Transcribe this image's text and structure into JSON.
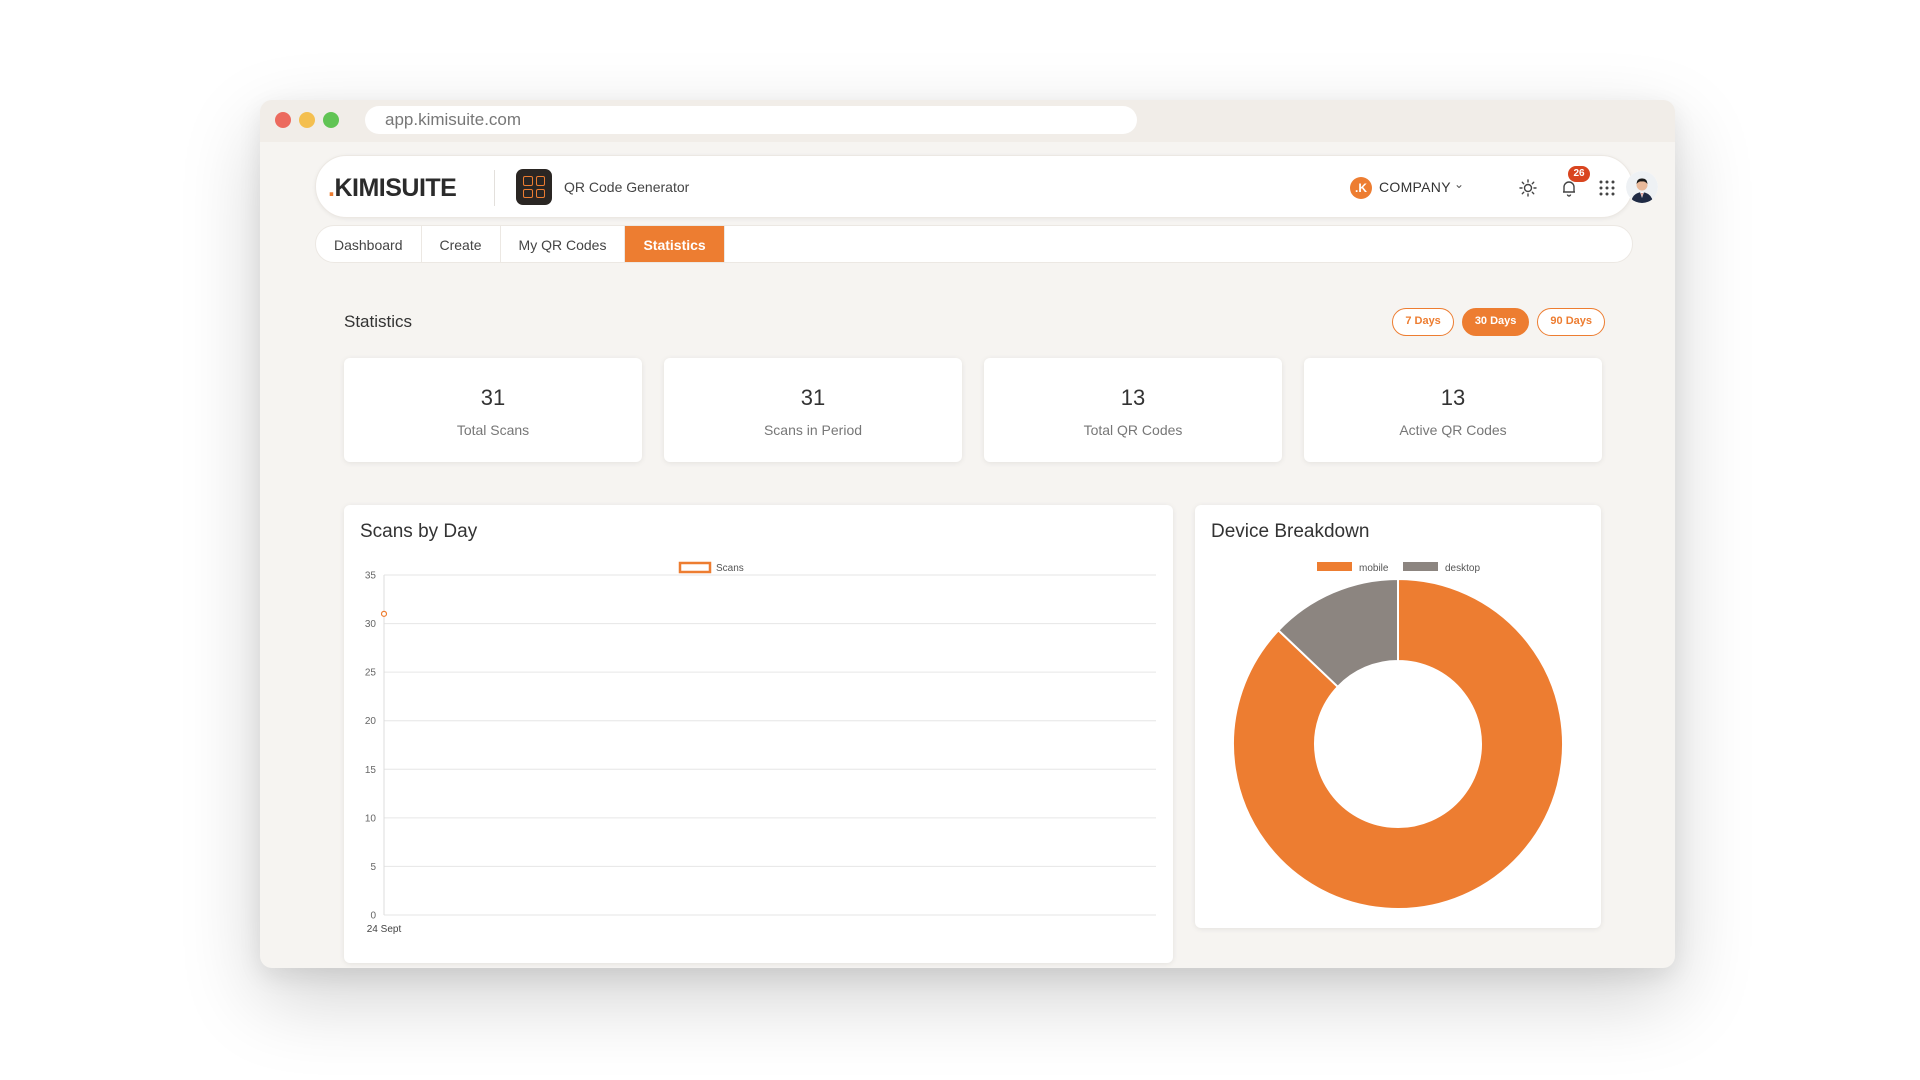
{
  "browser": {
    "url": "app.kimisuite.com"
  },
  "header": {
    "logo_prefix": ".",
    "logo_text": "KIMISUITE",
    "app_name": "QR Code Generator",
    "company_initial": ".K",
    "company_name": "COMPANY",
    "notification_count": "26"
  },
  "tabs": [
    {
      "label": "Dashboard"
    },
    {
      "label": "Create"
    },
    {
      "label": "My QR Codes"
    },
    {
      "label": "Statistics",
      "active": true
    }
  ],
  "statistics": {
    "title": "Statistics",
    "ranges": [
      {
        "label": "7 Days"
      },
      {
        "label": "30 Days",
        "active": true
      },
      {
        "label": "90 Days"
      }
    ],
    "cards": [
      {
        "value": "31",
        "label": "Total Scans"
      },
      {
        "value": "31",
        "label": "Scans in Period"
      },
      {
        "value": "13",
        "label": "Total QR Codes"
      },
      {
        "value": "13",
        "label": "Active QR Codes"
      }
    ]
  },
  "colors": {
    "accent": "#ed7d31",
    "desktop": "#8c8580"
  },
  "chart_data": [
    {
      "type": "line",
      "title": "Scans by Day",
      "x": [
        "24 Sept"
      ],
      "series": [
        {
          "name": "Scans",
          "values": [
            31
          ]
        }
      ],
      "ylim": [
        0,
        35
      ],
      "yticks": [
        0,
        5,
        10,
        15,
        20,
        25,
        30,
        35
      ],
      "grid": true,
      "legend": "top-center"
    },
    {
      "type": "pie",
      "title": "Device Breakdown",
      "labels": [
        "mobile",
        "desktop"
      ],
      "values": [
        27,
        4
      ],
      "legend": "top-center",
      "donut": true
    }
  ]
}
